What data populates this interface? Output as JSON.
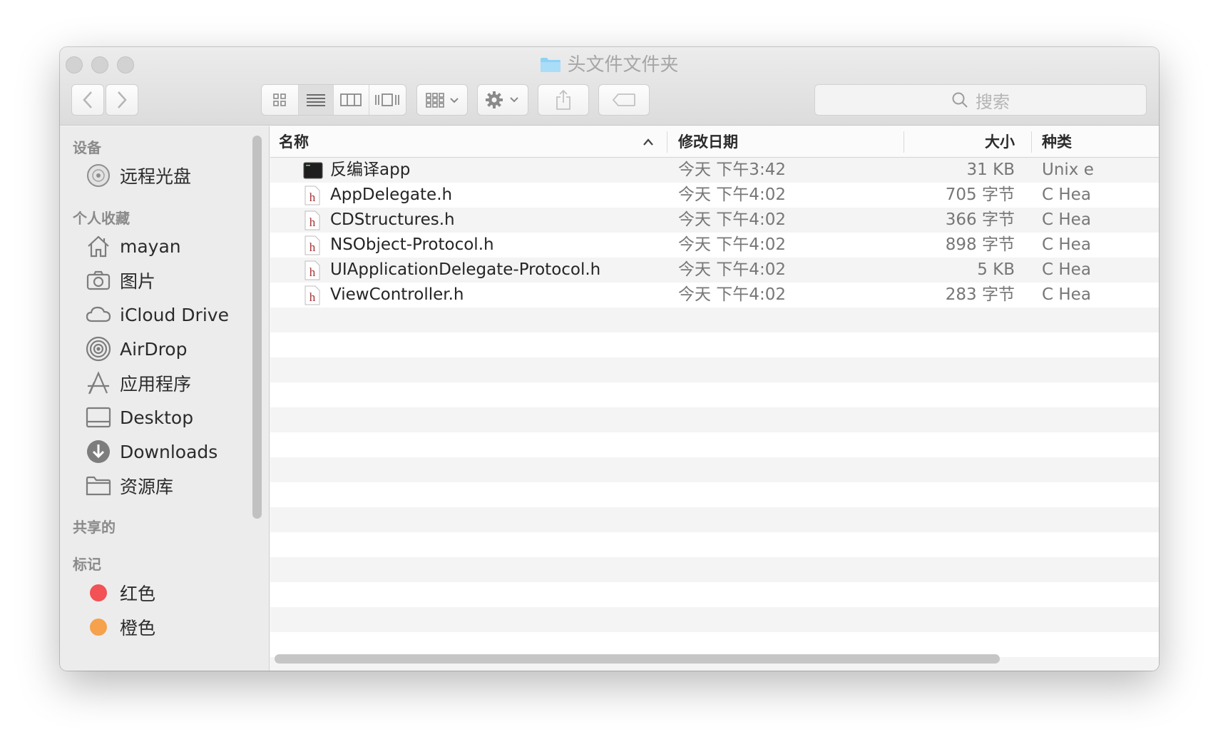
{
  "window": {
    "title": "头文件文件夹"
  },
  "toolbar": {
    "search_placeholder": "搜索"
  },
  "sidebar": {
    "sections": {
      "devices": "设备",
      "favorites": "个人收藏",
      "shared": "共享的",
      "tags": "标记"
    },
    "devices": [
      {
        "label": "远程光盘",
        "icon": "disc-icon"
      }
    ],
    "favorites": [
      {
        "label": "mayan",
        "icon": "home-icon"
      },
      {
        "label": "图片",
        "icon": "camera-icon"
      },
      {
        "label": "iCloud Drive",
        "icon": "cloud-icon"
      },
      {
        "label": "AirDrop",
        "icon": "airdrop-icon"
      },
      {
        "label": "应用程序",
        "icon": "applications-icon"
      },
      {
        "label": "Desktop",
        "icon": "desktop-icon"
      },
      {
        "label": "Downloads",
        "icon": "downloads-icon"
      },
      {
        "label": "资源库",
        "icon": "folder-icon"
      }
    ],
    "tags": [
      {
        "label": "红色",
        "color": "#f25155"
      },
      {
        "label": "橙色",
        "color": "#f6a14b"
      }
    ]
  },
  "list": {
    "columns": {
      "name": "名称",
      "date": "修改日期",
      "size": "大小",
      "kind": "种类"
    },
    "files": [
      {
        "name": "反编译app",
        "date": "今天 下午3:42",
        "size": "31 KB",
        "kind": "Unix e",
        "icon": "terminal-icon"
      },
      {
        "name": "AppDelegate.h",
        "date": "今天 下午4:02",
        "size": "705 字节",
        "kind": "C Hea",
        "icon": "header-file-icon"
      },
      {
        "name": "CDStructures.h",
        "date": "今天 下午4:02",
        "size": "366 字节",
        "kind": "C Hea",
        "icon": "header-file-icon"
      },
      {
        "name": "NSObject-Protocol.h",
        "date": "今天 下午4:02",
        "size": "898 字节",
        "kind": "C Hea",
        "icon": "header-file-icon"
      },
      {
        "name": "UIApplicationDelegate-Protocol.h",
        "date": "今天 下午4:02",
        "size": "5 KB",
        "kind": "C Hea",
        "icon": "header-file-icon"
      },
      {
        "name": "ViewController.h",
        "date": "今天 下午4:02",
        "size": "283 字节",
        "kind": "C Hea",
        "icon": "header-file-icon"
      }
    ]
  }
}
